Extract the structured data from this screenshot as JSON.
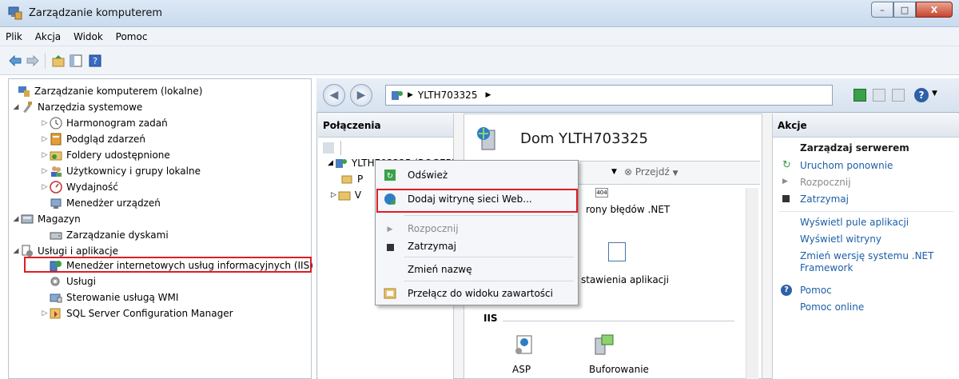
{
  "window": {
    "title": "Zarządzanie komputerem",
    "minimize": "–",
    "maximize": "□",
    "close": "X"
  },
  "menubar": [
    "Plik",
    "Akcja",
    "Widok",
    "Pomoc"
  ],
  "tree": {
    "root": "Zarządzanie komputerem (lokalne)",
    "system_tools": "Narzędzia systemowe",
    "task_scheduler": "Harmonogram zadań",
    "event_viewer": "Podgląd zdarzeń",
    "shared_folders": "Foldery udostępnione",
    "users_groups": "Użytkownicy i grupy lokalne",
    "performance": "Wydajność",
    "device_manager": "Menedżer urządzeń",
    "storage": "Magazyn",
    "disk_mgmt": "Zarządzanie dyskami",
    "services_apps": "Usługi i aplikacje",
    "iis": "Menedżer internetowych usług informacyjnych (IIS)",
    "services": "Usługi",
    "wmi": "Sterowanie usługą WMI",
    "sql": "SQL Server Configuration Manager"
  },
  "iis": {
    "address": "YLTH703325",
    "connections_header": "Połączenia",
    "conn_server": "YLTH703325 (ROGER\\",
    "conn_sub1": "P",
    "conn_sub2": "V",
    "home_title": "Dom YLTH703325",
    "goto": "Przejdź",
    "feature_error_pages": "rony błędów .NET",
    "feature_app_settings": "stawienia aplikacji",
    "iis_group": "IIS",
    "feature_asp": "ASP",
    "feature_caching": "Buforowanie",
    "icon_404": "404"
  },
  "actions": {
    "header": "Akcje",
    "manage_server": "Zarządzaj serwerem",
    "restart": "Uruchom ponownie",
    "start": "Rozpocznij",
    "stop": "Zatrzymaj",
    "view_pools": "Wyświetl pule aplikacji",
    "view_sites": "Wyświetl witryny",
    "change_net_1": "Zmień wersję systemu .NET",
    "change_net_2": "Framework",
    "help": "Pomoc",
    "help_online": "Pomoc online"
  },
  "context_menu": {
    "refresh": "Odśwież",
    "add_site": "Dodaj witrynę sieci Web...",
    "start": "Rozpocznij",
    "stop": "Zatrzymaj",
    "rename": "Zmień nazwę",
    "switch_view": "Przełącz do widoku zawartości"
  }
}
